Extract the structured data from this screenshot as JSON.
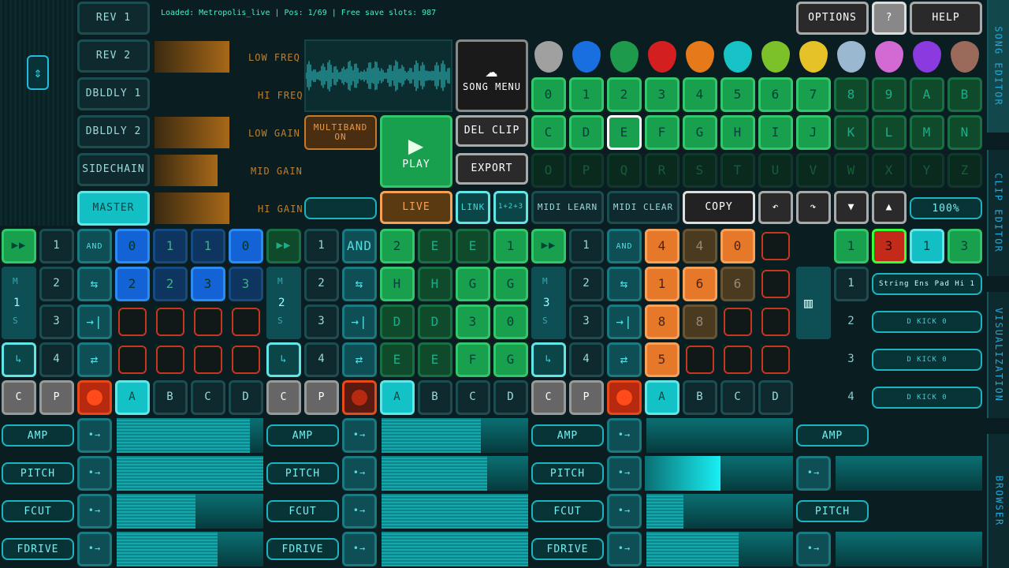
{
  "status": "Loaded: Metropolis_live | Pos: 1/69 | Free save slots: 987",
  "fx": {
    "rev1": "REV 1",
    "rev2": "REV 2",
    "dbldly1": "DBLDLY 1",
    "dbldly2": "DBLDLY 2",
    "sidechain": "SIDECHAIN",
    "master": "MASTER"
  },
  "eq": {
    "lowfreq": "LOW FREQ",
    "hifreq": "HI FREQ",
    "lowgain": "LOW GAIN",
    "midgain": "MID GAIN",
    "higain": "HI GAIN"
  },
  "multiband": "MULTIBAND ON",
  "song_menu": "SONG MENU",
  "play": "PLAY",
  "del_clip": "DEL CLIP",
  "export": "EXPORT",
  "live": "LIVE",
  "link": "LINK",
  "triplet": "1+2+3",
  "midi_learn": "MIDI LEARN",
  "midi_clear": "MIDI CLEAR",
  "copy": "COPY",
  "zoom": "100%",
  "options": "OPTIONS",
  "question": "?",
  "help": "HELP",
  "side_tabs": {
    "song": "SONG EDITOR",
    "clip": "CLIP EDITOR",
    "vis": "VISUALIZATION",
    "browser": "BROWSER"
  },
  "pattern_rows": [
    [
      "0",
      "1",
      "2",
      "3",
      "4",
      "5",
      "6",
      "7",
      "8",
      "9",
      "A",
      "B"
    ],
    [
      "C",
      "D",
      "E",
      "F",
      "G",
      "H",
      "I",
      "J",
      "K",
      "L",
      "M",
      "N"
    ],
    [
      "O",
      "P",
      "Q",
      "R",
      "S",
      "T",
      "U",
      "V",
      "W",
      "X",
      "Y",
      "Z"
    ]
  ],
  "and_label": "AND",
  "m": "M",
  "s": "S",
  "track_nums": [
    "1",
    "2",
    "3"
  ],
  "small_nums": [
    "1",
    "2",
    "3",
    "4"
  ],
  "abcd": [
    "A",
    "B",
    "C",
    "D"
  ],
  "c": "C",
  "p": "P",
  "t1_clips": [
    "0",
    "1",
    "1",
    "0",
    "2",
    "2",
    "3",
    "3"
  ],
  "t2_clips": [
    "2",
    "E",
    "E",
    "1",
    "H",
    "H",
    "G",
    "G",
    "D",
    "D",
    "3",
    "0",
    "E",
    "E",
    "F",
    "G"
  ],
  "t3_clips": [
    "4",
    "4",
    "0",
    "1",
    "6",
    "6",
    "8",
    "8",
    "5"
  ],
  "t4_top": [
    "1",
    "3",
    "1",
    "3"
  ],
  "t4_slots": [
    "String Ens Pad Hi 1",
    "D KICK 0",
    "D KICK 0",
    "D KICK 0"
  ],
  "mods": {
    "amp": "AMP",
    "pitch": "PITCH",
    "fcut": "FCUT",
    "fdrive": "FDRIVE"
  },
  "colors": {
    "teal": "#12bfc4",
    "green": "#19a04f",
    "blue": "#1463d6",
    "orange": "#e6782a",
    "red": "#e13a1a"
  },
  "bars": {
    "t1": [
      0.91,
      1.0,
      0.54,
      0.69
    ],
    "t2": [
      0.68,
      0.72,
      1.0,
      1.0
    ],
    "t3": [
      0.0,
      0.5,
      0.25,
      0.63
    ],
    "t4": [
      0.0,
      0.0,
      0.0,
      0.0
    ]
  }
}
